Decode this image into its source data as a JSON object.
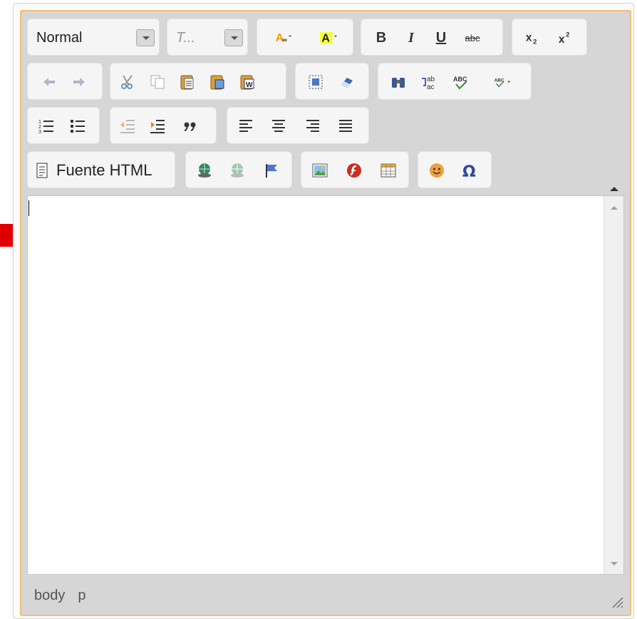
{
  "toolbar": {
    "format_combo": {
      "value": "Normal"
    },
    "font_combo": {
      "value": "T..."
    },
    "source_button": {
      "label": "Fuente HTML"
    },
    "bold_label": "B",
    "italic_label": "I",
    "underline_label": "U",
    "strike_label": "abc"
  },
  "status_bar": {
    "path": [
      "body",
      "p"
    ]
  },
  "colors": {
    "editor_border": "#f0c070",
    "toolbar_bg": "#d6d6d6",
    "arrow": "#e00000"
  },
  "icons": [
    "text-color-icon",
    "background-color-icon",
    "bold-icon",
    "italic-icon",
    "underline-icon",
    "strikethrough-icon",
    "subscript-icon",
    "superscript-icon",
    "undo-icon",
    "redo-icon",
    "cut-icon",
    "copy-icon",
    "paste-icon",
    "paste-text-icon",
    "paste-word-icon",
    "select-all-icon",
    "remove-format-icon",
    "find-icon",
    "replace-icon",
    "spellcheck-icon",
    "spellcheck-as-you-type-icon",
    "numbered-list-icon",
    "bulleted-list-icon",
    "outdent-icon",
    "indent-icon",
    "blockquote-icon",
    "align-left-icon",
    "align-center-icon",
    "align-right-icon",
    "justify-icon",
    "source-icon",
    "link-icon",
    "unlink-icon",
    "anchor-icon",
    "image-icon",
    "flash-icon",
    "table-icon",
    "smiley-icon",
    "special-char-icon"
  ]
}
